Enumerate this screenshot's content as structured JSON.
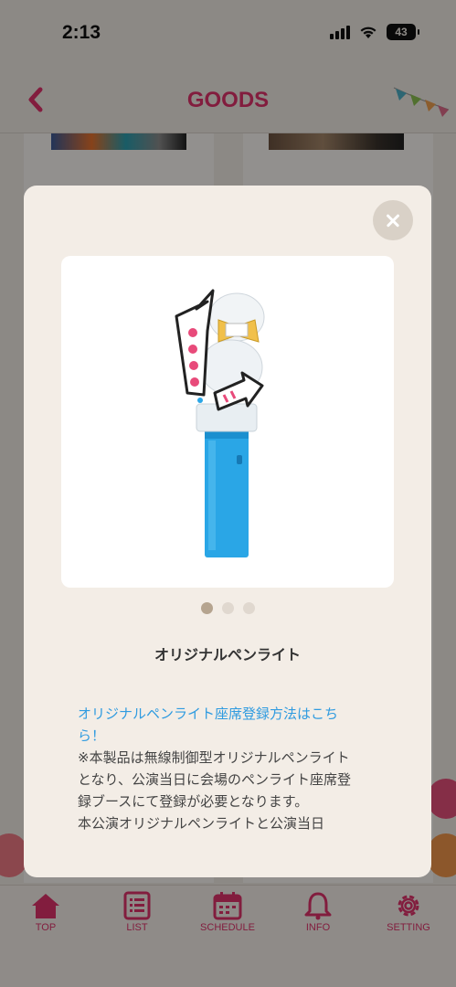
{
  "status": {
    "time": "2:13",
    "battery": "43"
  },
  "header": {
    "title": "GOODS"
  },
  "tabs": [
    {
      "label": "TOP",
      "icon": "home-icon"
    },
    {
      "label": "LIST",
      "icon": "list-icon"
    },
    {
      "label": "SCHEDULE",
      "icon": "calendar-icon"
    },
    {
      "label": "INFO",
      "icon": "bell-icon"
    },
    {
      "label": "SETTING",
      "icon": "gear-icon"
    }
  ],
  "modal": {
    "product_name": "オリジナルペンライト",
    "link_text": "オリジナルペンライト座席登録方法はこちら！",
    "description_1": "※本製品は無線制御型オリジナルペンライトとなり、公演当日に会場のペンライト座席登録ブースにて登録が必要となります。",
    "description_2": "本公演オリジナルペンライトと公演当日",
    "carousel": {
      "count": 3,
      "active_index": 1
    }
  },
  "colors": {
    "accent": "#e0336b",
    "link": "#2f9be0",
    "modal_bg": "#f3ede6"
  }
}
